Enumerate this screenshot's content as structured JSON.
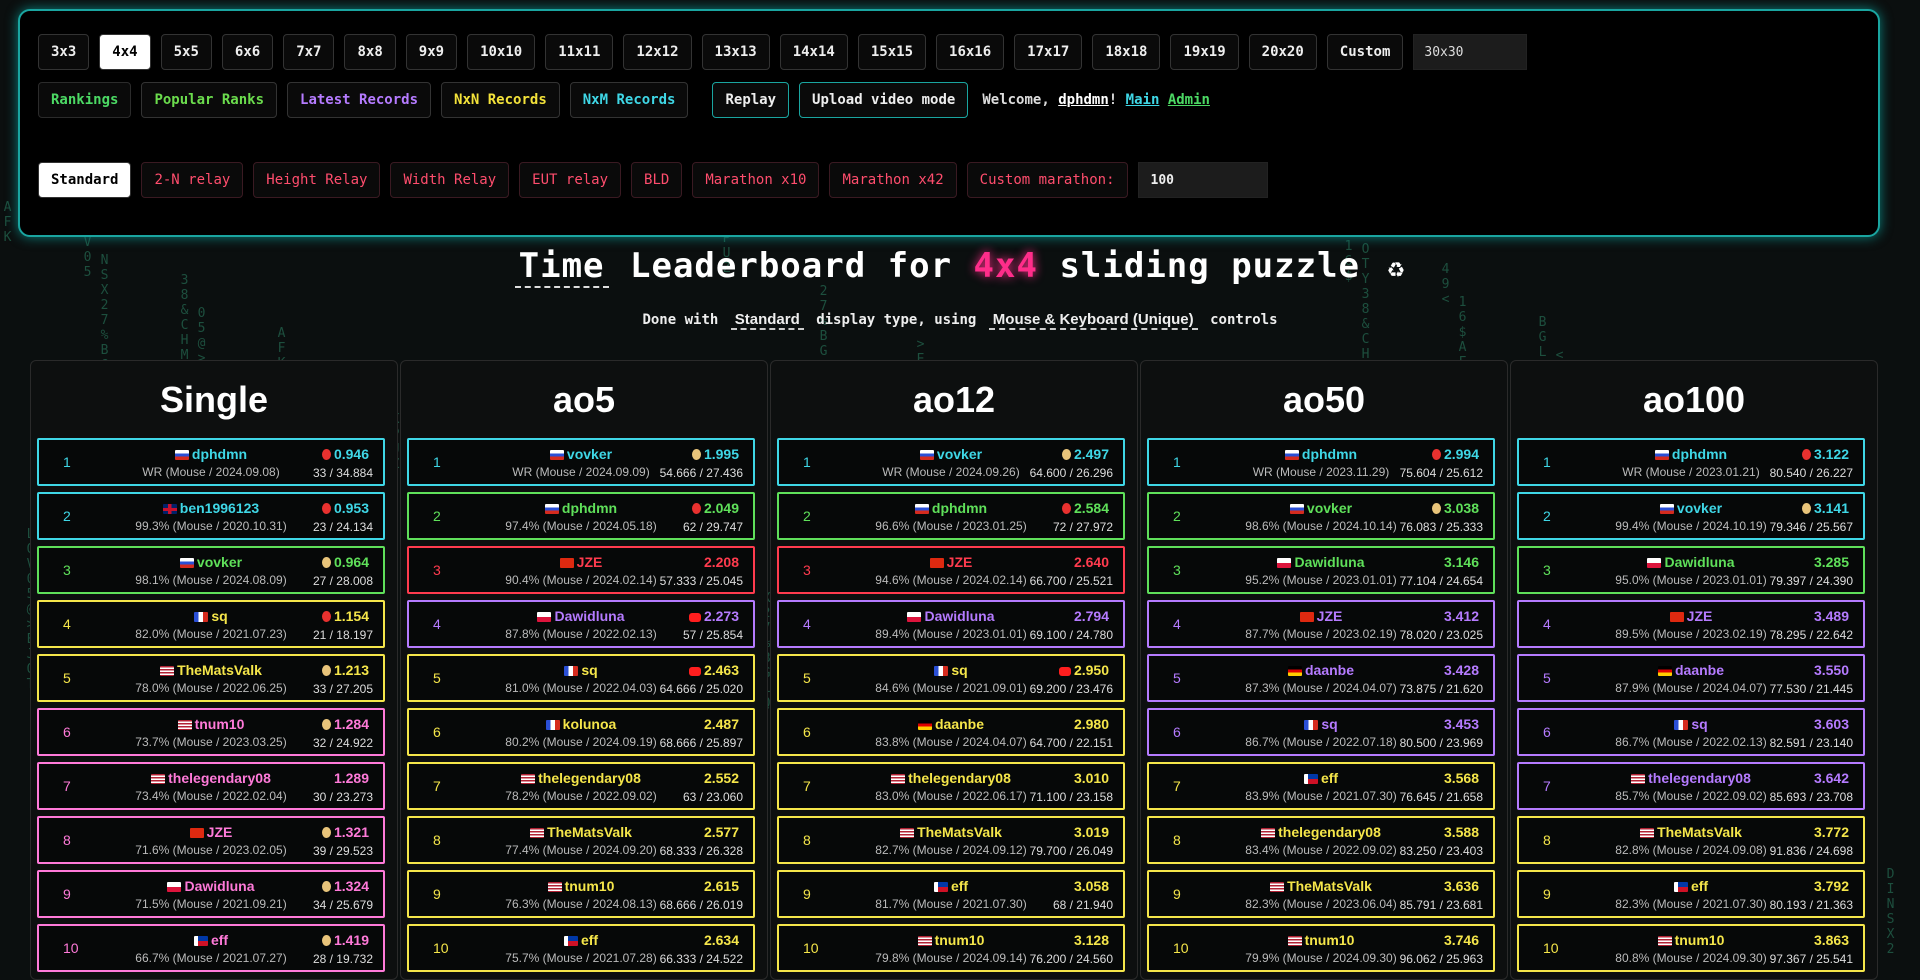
{
  "sizes": [
    "3x3",
    "4x4",
    "5x5",
    "6x6",
    "7x7",
    "8x8",
    "9x9",
    "10x10",
    "11x11",
    "12x12",
    "13x13",
    "14x14",
    "15x15",
    "16x16",
    "17x17",
    "18x18",
    "19x19",
    "20x20",
    "Custom"
  ],
  "active_size": "4x4",
  "size_input_value": "30x30",
  "nav": {
    "rankings": "Rankings",
    "popular": "Popular Ranks",
    "latest": "Latest Records",
    "nxn": "NxN Records",
    "nxm": "NxM Records",
    "replay": "Replay",
    "upload": "Upload video mode",
    "welcome_prefix": "Welcome,",
    "username": "dphdmn",
    "excl": "!",
    "main": "Main",
    "admin": "Admin"
  },
  "modes": [
    "Standard",
    "2-N relay",
    "Height Relay",
    "Width Relay",
    "EUT relay",
    "BLD",
    "Marathon x10",
    "Marathon x42",
    "Custom marathon:"
  ],
  "marathon_value": "100",
  "heading": {
    "time": "Time",
    "part1": "Leaderboard for",
    "size": "4x4",
    "part2": "sliding puzzle",
    "icon": "♻"
  },
  "subheading": {
    "part1": "Done with",
    "display": "Standard",
    "part2": "display type, using",
    "controls": "Mouse & Keyboard (Unique)",
    "part3": "controls"
  },
  "colors": {
    "rank_borders": [
      "#1fc9d9",
      "#1fc9d9",
      "#3fd35a",
      "#e8d53a",
      "#cfc23a",
      "#d36fd6",
      "#cfc23a",
      "#d36fd6",
      "#d36fd6",
      "#cfc23a"
    ],
    "tier_cyan": "#3fd7e6",
    "tier_green": "#5fe05a",
    "tier_red": "#ff3b4e",
    "tier_purple": "#b57bff",
    "tier_yellow": "#f5e64a",
    "tier_pink": "#ff7ad9"
  },
  "columns": [
    {
      "title": "Single",
      "entries": [
        {
          "rank": "1",
          "name": "dphdmn",
          "meta": "WR (Mouse / 2024.09.08)",
          "score": "0.946",
          "extra": "33 / 34.884",
          "tier": "cyan",
          "flag": "ru",
          "dev": "red"
        },
        {
          "rank": "2",
          "name": "ben1996123",
          "meta": "99.3% (Mouse / 2020.10.31)",
          "score": "0.953",
          "extra": "23 / 24.134",
          "tier": "cyan",
          "flag": "gb",
          "dev": "red"
        },
        {
          "rank": "3",
          "name": "vovker",
          "meta": "98.1% (Mouse / 2024.08.09)",
          "score": "0.964",
          "extra": "27 / 28.008",
          "tier": "green",
          "flag": "ru",
          "dev": "tan"
        },
        {
          "rank": "4",
          "name": "sq",
          "meta": "82.0% (Mouse / 2021.07.23)",
          "score": "1.154",
          "extra": "21 / 18.197",
          "tier": "yellow",
          "flag": "fr",
          "dev": "red"
        },
        {
          "rank": "5",
          "name": "TheMatsValk",
          "meta": "78.0% (Mouse / 2022.06.25)",
          "score": "1.213",
          "extra": "33 / 27.205",
          "tier": "yellow",
          "flag": "us",
          "dev": "tan"
        },
        {
          "rank": "6",
          "name": "tnum10",
          "meta": "73.7% (Mouse / 2023.03.25)",
          "score": "1.284",
          "extra": "32 / 24.922",
          "tier": "pink",
          "flag": "us",
          "dev": "tan"
        },
        {
          "rank": "7",
          "name": "thelegendary08",
          "meta": "73.4% (Mouse / 2022.02.04)",
          "score": "1.289",
          "extra": "30 / 23.273",
          "tier": "pink",
          "flag": "us",
          "dev": "none"
        },
        {
          "rank": "8",
          "name": "JZE",
          "meta": "71.6% (Mouse / 2023.02.05)",
          "score": "1.321",
          "extra": "39 / 29.523",
          "tier": "pink",
          "flag": "cn",
          "dev": "tan"
        },
        {
          "rank": "9",
          "name": "Dawidluna",
          "meta": "71.5% (Mouse / 2021.09.21)",
          "score": "1.324",
          "extra": "34 / 25.679",
          "tier": "pink",
          "flag": "pl",
          "dev": "tan"
        },
        {
          "rank": "10",
          "name": "eff",
          "meta": "66.7% (Mouse / 2021.07.27)",
          "score": "1.419",
          "extra": "28 / 19.732",
          "tier": "pink",
          "flag": "ph",
          "dev": "tan"
        }
      ]
    },
    {
      "title": "ao5",
      "entries": [
        {
          "rank": "1",
          "name": "vovker",
          "meta": "WR (Mouse / 2024.09.09)",
          "score": "1.995",
          "extra": "54.666 / 27.436",
          "tier": "cyan",
          "flag": "ru",
          "dev": "tan"
        },
        {
          "rank": "2",
          "name": "dphdmn",
          "meta": "97.4% (Mouse / 2024.05.18)",
          "score": "2.049",
          "extra": "62 / 29.747",
          "tier": "green",
          "flag": "ru",
          "dev": "red"
        },
        {
          "rank": "3",
          "name": "JZE",
          "meta": "90.4% (Mouse / 2024.02.14)",
          "score": "2.208",
          "extra": "57.333 / 25.045",
          "tier": "red",
          "flag": "cn",
          "dev": "none"
        },
        {
          "rank": "4",
          "name": "Dawidluna",
          "meta": "87.8% (Mouse / 2022.02.13)",
          "score": "2.273",
          "extra": "57 / 25.854",
          "tier": "purple",
          "flag": "pl",
          "dev": "yt"
        },
        {
          "rank": "5",
          "name": "sq",
          "meta": "81.0% (Mouse / 2022.04.03)",
          "score": "2.463",
          "extra": "64.666 / 25.020",
          "tier": "yellow",
          "flag": "fr",
          "dev": "yt"
        },
        {
          "rank": "6",
          "name": "kolunoa",
          "meta": "80.2% (Mouse / 2024.09.19)",
          "score": "2.487",
          "extra": "68.666 / 25.897",
          "tier": "yellow",
          "flag": "fr",
          "dev": "none"
        },
        {
          "rank": "7",
          "name": "thelegendary08",
          "meta": "78.2% (Mouse / 2022.09.02)",
          "score": "2.552",
          "extra": "63 / 23.060",
          "tier": "yellow",
          "flag": "us",
          "dev": "none"
        },
        {
          "rank": "8",
          "name": "TheMatsValk",
          "meta": "77.4% (Mouse / 2024.09.20)",
          "score": "2.577",
          "extra": "68.333 / 26.328",
          "tier": "yellow",
          "flag": "us",
          "dev": "none"
        },
        {
          "rank": "9",
          "name": "tnum10",
          "meta": "76.3% (Mouse / 2024.08.13)",
          "score": "2.615",
          "extra": "68.666 / 26.019",
          "tier": "yellow",
          "flag": "us",
          "dev": "none"
        },
        {
          "rank": "10",
          "name": "eff",
          "meta": "75.7% (Mouse / 2021.07.28)",
          "score": "2.634",
          "extra": "66.333 / 24.522",
          "tier": "yellow",
          "flag": "ph",
          "dev": "none"
        }
      ]
    },
    {
      "title": "ao12",
      "entries": [
        {
          "rank": "1",
          "name": "vovker",
          "meta": "WR (Mouse / 2024.09.26)",
          "score": "2.497",
          "extra": "64.600 / 26.296",
          "tier": "cyan",
          "flag": "ru",
          "dev": "tan"
        },
        {
          "rank": "2",
          "name": "dphdmn",
          "meta": "96.6% (Mouse / 2023.01.25)",
          "score": "2.584",
          "extra": "72 / 27.972",
          "tier": "green",
          "flag": "ru",
          "dev": "red"
        },
        {
          "rank": "3",
          "name": "JZE",
          "meta": "94.6% (Mouse / 2024.02.14)",
          "score": "2.640",
          "extra": "66.700 / 25.521",
          "tier": "red",
          "flag": "cn",
          "dev": "none"
        },
        {
          "rank": "4",
          "name": "Dawidluna",
          "meta": "89.4% (Mouse / 2023.01.01)",
          "score": "2.794",
          "extra": "69.100 / 24.780",
          "tier": "purple",
          "flag": "pl",
          "dev": "none"
        },
        {
          "rank": "5",
          "name": "sq",
          "meta": "84.6% (Mouse / 2021.09.01)",
          "score": "2.950",
          "extra": "69.200 / 23.476",
          "tier": "yellow",
          "flag": "fr",
          "dev": "yt"
        },
        {
          "rank": "6",
          "name": "daanbe",
          "meta": "83.8% (Mouse / 2024.04.07)",
          "score": "2.980",
          "extra": "64.700 / 22.151",
          "tier": "yellow",
          "flag": "de",
          "dev": "none"
        },
        {
          "rank": "7",
          "name": "thelegendary08",
          "meta": "83.0% (Mouse / 2022.06.17)",
          "score": "3.010",
          "extra": "71.100 / 23.158",
          "tier": "yellow",
          "flag": "us",
          "dev": "none"
        },
        {
          "rank": "8",
          "name": "TheMatsValk",
          "meta": "82.7% (Mouse / 2024.09.12)",
          "score": "3.019",
          "extra": "79.700 / 26.049",
          "tier": "yellow",
          "flag": "us",
          "dev": "none"
        },
        {
          "rank": "9",
          "name": "eff",
          "meta": "81.7% (Mouse / 2021.07.30)",
          "score": "3.058",
          "extra": "68 / 21.940",
          "tier": "yellow",
          "flag": "ph",
          "dev": "none"
        },
        {
          "rank": "10",
          "name": "tnum10",
          "meta": "79.8% (Mouse / 2024.09.14)",
          "score": "3.128",
          "extra": "76.200 / 24.560",
          "tier": "yellow",
          "flag": "us",
          "dev": "none"
        }
      ]
    },
    {
      "title": "ao50",
      "entries": [
        {
          "rank": "1",
          "name": "dphdmn",
          "meta": "WR (Mouse / 2023.11.29)",
          "score": "2.994",
          "extra": "75.604 / 25.612",
          "tier": "cyan",
          "flag": "ru",
          "dev": "red"
        },
        {
          "rank": "2",
          "name": "vovker",
          "meta": "98.6% (Mouse / 2024.10.14)",
          "score": "3.038",
          "extra": "76.083 / 25.333",
          "tier": "green",
          "flag": "ru",
          "dev": "tan"
        },
        {
          "rank": "3",
          "name": "Dawidluna",
          "meta": "95.2% (Mouse / 2023.01.01)",
          "score": "3.146",
          "extra": "77.104 / 24.654",
          "tier": "green",
          "flag": "pl",
          "dev": "none"
        },
        {
          "rank": "4",
          "name": "JZE",
          "meta": "87.7% (Mouse / 2023.02.19)",
          "score": "3.412",
          "extra": "78.020 / 23.025",
          "tier": "purple",
          "flag": "cn",
          "dev": "none"
        },
        {
          "rank": "5",
          "name": "daanbe",
          "meta": "87.3% (Mouse / 2024.04.07)",
          "score": "3.428",
          "extra": "73.875 / 21.620",
          "tier": "purple",
          "flag": "de",
          "dev": "none"
        },
        {
          "rank": "6",
          "name": "sq",
          "meta": "86.7% (Mouse / 2022.07.18)",
          "score": "3.453",
          "extra": "80.500 / 23.969",
          "tier": "purple",
          "flag": "fr",
          "dev": "none"
        },
        {
          "rank": "7",
          "name": "eff",
          "meta": "83.9% (Mouse / 2021.07.30)",
          "score": "3.568",
          "extra": "76.645 / 21.658",
          "tier": "yellow",
          "flag": "ph",
          "dev": "none"
        },
        {
          "rank": "8",
          "name": "thelegendary08",
          "meta": "83.4% (Mouse / 2022.09.02)",
          "score": "3.588",
          "extra": "83.250 / 23.403",
          "tier": "yellow",
          "flag": "us",
          "dev": "none"
        },
        {
          "rank": "9",
          "name": "TheMatsValk",
          "meta": "82.3% (Mouse / 2023.06.04)",
          "score": "3.636",
          "extra": "85.791 / 23.681",
          "tier": "yellow",
          "flag": "us",
          "dev": "none"
        },
        {
          "rank": "10",
          "name": "tnum10",
          "meta": "79.9% (Mouse / 2024.09.30)",
          "score": "3.746",
          "extra": "96.062 / 25.963",
          "tier": "yellow",
          "flag": "us",
          "dev": "none"
        }
      ]
    },
    {
      "title": "ao100",
      "entries": [
        {
          "rank": "1",
          "name": "dphdmn",
          "meta": "WR (Mouse / 2023.01.21)",
          "score": "3.122",
          "extra": "80.540 / 26.227",
          "tier": "cyan",
          "flag": "ru",
          "dev": "red"
        },
        {
          "rank": "2",
          "name": "vovker",
          "meta": "99.4% (Mouse / 2024.10.19)",
          "score": "3.141",
          "extra": "79.346 / 25.567",
          "tier": "cyan",
          "flag": "ru",
          "dev": "tan"
        },
        {
          "rank": "3",
          "name": "Dawidluna",
          "meta": "95.0% (Mouse / 2023.01.01)",
          "score": "3.285",
          "extra": "79.397 / 24.390",
          "tier": "green",
          "flag": "pl",
          "dev": "none"
        },
        {
          "rank": "4",
          "name": "JZE",
          "meta": "89.5% (Mouse / 2023.02.19)",
          "score": "3.489",
          "extra": "78.295 / 22.642",
          "tier": "purple",
          "flag": "cn",
          "dev": "none"
        },
        {
          "rank": "5",
          "name": "daanbe",
          "meta": "87.9% (Mouse / 2024.04.07)",
          "score": "3.550",
          "extra": "77.530 / 21.445",
          "tier": "purple",
          "flag": "de",
          "dev": "none"
        },
        {
          "rank": "6",
          "name": "sq",
          "meta": "86.7% (Mouse / 2022.02.13)",
          "score": "3.603",
          "extra": "82.591 / 23.140",
          "tier": "purple",
          "flag": "fr",
          "dev": "none"
        },
        {
          "rank": "7",
          "name": "thelegendary08",
          "meta": "85.7% (Mouse / 2022.09.02)",
          "score": "3.642",
          "extra": "85.693 / 23.708",
          "tier": "purple",
          "flag": "us",
          "dev": "none"
        },
        {
          "rank": "8",
          "name": "TheMatsValk",
          "meta": "82.8% (Mouse / 2024.09.08)",
          "score": "3.772",
          "extra": "91.836 / 24.698",
          "tier": "yellow",
          "flag": "us",
          "dev": "none"
        },
        {
          "rank": "9",
          "name": "eff",
          "meta": "82.3% (Mouse / 2021.07.30)",
          "score": "3.792",
          "extra": "80.193 / 21.363",
          "tier": "yellow",
          "flag": "ph",
          "dev": "none"
        },
        {
          "rank": "10",
          "name": "tnum10",
          "meta": "80.8% (Mouse / 2024.09.30)",
          "score": "3.863",
          "extra": "97.367 / 25.541",
          "tier": "yellow",
          "flag": "us",
          "dev": "none"
        }
      ]
    }
  ]
}
